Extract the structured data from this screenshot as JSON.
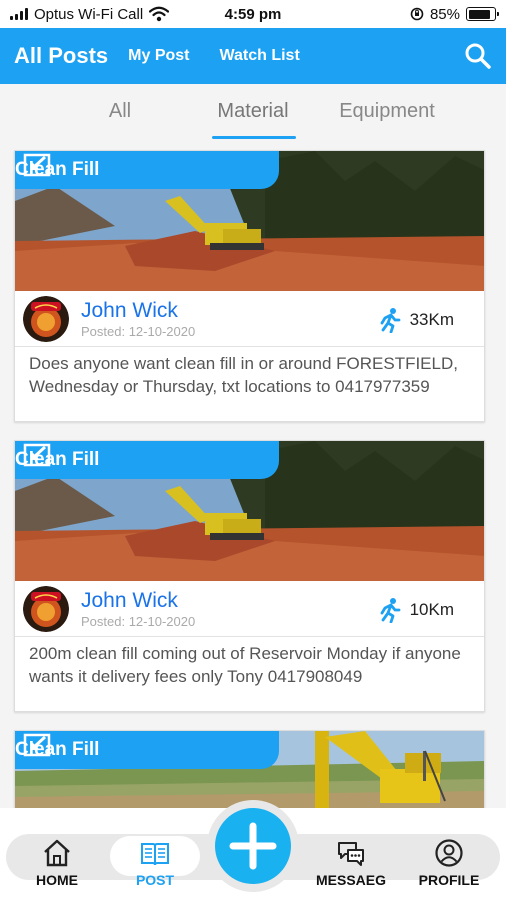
{
  "status_bar": {
    "carrier": "Optus Wi-Fi Call",
    "time": "4:59 pm",
    "battery": "85%",
    "battery_level": 0.85
  },
  "header": {
    "title": "All Posts",
    "links": [
      "My Post",
      "Watch List"
    ],
    "search_icon": "search-icon"
  },
  "tabs": [
    {
      "label": "All",
      "active": false
    },
    {
      "label": "Material",
      "active": true
    },
    {
      "label": "Equipment",
      "active": false
    }
  ],
  "posts": [
    {
      "category": "Clean Fill",
      "author": "John Wick",
      "posted": "Posted: 12-10-2020",
      "distance": "33Km",
      "text": "Does anyone want clean fill in or around FORESTFIELD, Wednesday or Thursday, txt locations to 0417977359"
    },
    {
      "category": "Clean Fill",
      "author": "John Wick",
      "posted": "Posted: 12-10-2020",
      "distance": "10Km",
      "text": "200m clean fill coming out of Reservoir Monday if anyone wants it delivery fees only Tony 0417908049"
    },
    {
      "category": "Clean Fill"
    }
  ],
  "bottom_nav": {
    "items": [
      {
        "label": "HOME",
        "icon": "home-icon"
      },
      {
        "label": "POST",
        "icon": "book-icon",
        "active": true
      },
      {
        "label": "MESSAEG",
        "icon": "message-icon"
      },
      {
        "label": "PROFILE",
        "icon": "profile-icon"
      }
    ],
    "fab_icon": "plus-icon"
  },
  "colors": {
    "accent": "#1da1f2",
    "author": "#1a73e8",
    "text": "#555555"
  }
}
